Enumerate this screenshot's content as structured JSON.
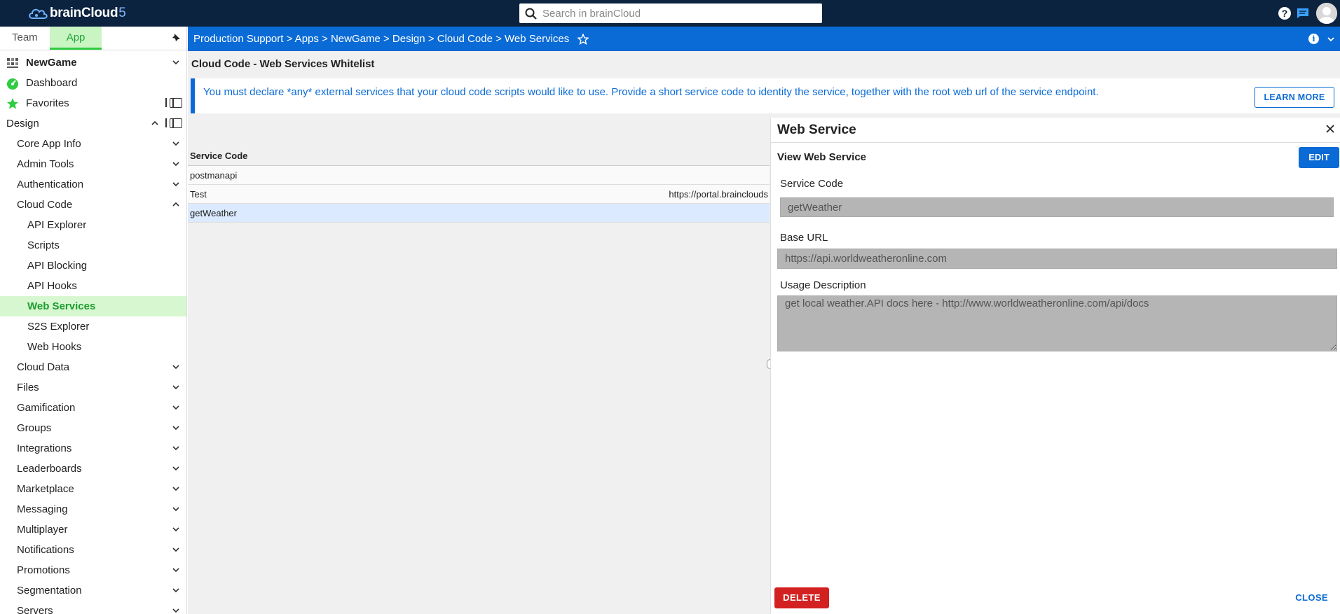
{
  "header": {
    "logo_text": "brainCloud",
    "logo_version": "5",
    "search_placeholder": "Search in brainCloud",
    "icons": [
      "help-icon",
      "chat-icon",
      "avatar"
    ]
  },
  "sidebar": {
    "tabs": [
      {
        "label": "Team"
      },
      {
        "label": "App"
      }
    ],
    "app_name": "NewGame",
    "quick_links": [
      {
        "label": "Dashboard",
        "icon": "dashboard-icon"
      },
      {
        "label": "Favorites",
        "icon": "star-icon"
      }
    ],
    "section": "Design",
    "items": [
      {
        "label": "Core App Info"
      },
      {
        "label": "Admin Tools"
      },
      {
        "label": "Authentication"
      },
      {
        "label": "Cloud Code"
      },
      {
        "label": "Cloud Data"
      },
      {
        "label": "Files"
      },
      {
        "label": "Gamification"
      },
      {
        "label": "Groups"
      },
      {
        "label": "Integrations"
      },
      {
        "label": "Leaderboards"
      },
      {
        "label": "Marketplace"
      },
      {
        "label": "Messaging"
      },
      {
        "label": "Multiplayer"
      },
      {
        "label": "Notifications"
      },
      {
        "label": "Promotions"
      },
      {
        "label": "Segmentation"
      },
      {
        "label": "Servers"
      }
    ],
    "cloud_code_children": [
      {
        "label": "API Explorer"
      },
      {
        "label": "Scripts"
      },
      {
        "label": "API Blocking"
      },
      {
        "label": "API Hooks"
      },
      {
        "label": "Web Services"
      },
      {
        "label": "S2S Explorer"
      },
      {
        "label": "Web Hooks"
      }
    ]
  },
  "breadcrumb": {
    "text": "Production Support > Apps > NewGame > Design > Cloud Code > Web Services"
  },
  "page": {
    "title": "Cloud Code - Web Services Whitelist",
    "banner_text": "You must declare *any* external services that your cloud code scripts would like to use. Provide a short service code to identity the service, together with the root web url of the service endpoint.",
    "learn_more": "LEARN MORE",
    "table": {
      "column": "Service Code",
      "rows": [
        {
          "code": "postmanapi",
          "url": ""
        },
        {
          "code": "Test",
          "url": "https://portal.brainclouds"
        },
        {
          "code": "getWeather",
          "url": ""
        }
      ]
    }
  },
  "drawer": {
    "title": "Web Service",
    "subtitle": "View Web Service",
    "edit": "EDIT",
    "service_code_label": "Service Code",
    "service_code_value": "getWeather",
    "base_url_label": "Base URL",
    "base_url_value": "https://api.worldweatheronline.com",
    "usage_label": "Usage Description",
    "usage_value": "get local weather.API docs here - http://www.worldweatheronline.com/api/docs",
    "delete": "DELETE",
    "close": "CLOSE"
  },
  "colors": {
    "topbar": "#0c2340",
    "accent_blue": "#0a6bd6",
    "accent_green": "#2ecc40",
    "danger": "#d32020"
  }
}
